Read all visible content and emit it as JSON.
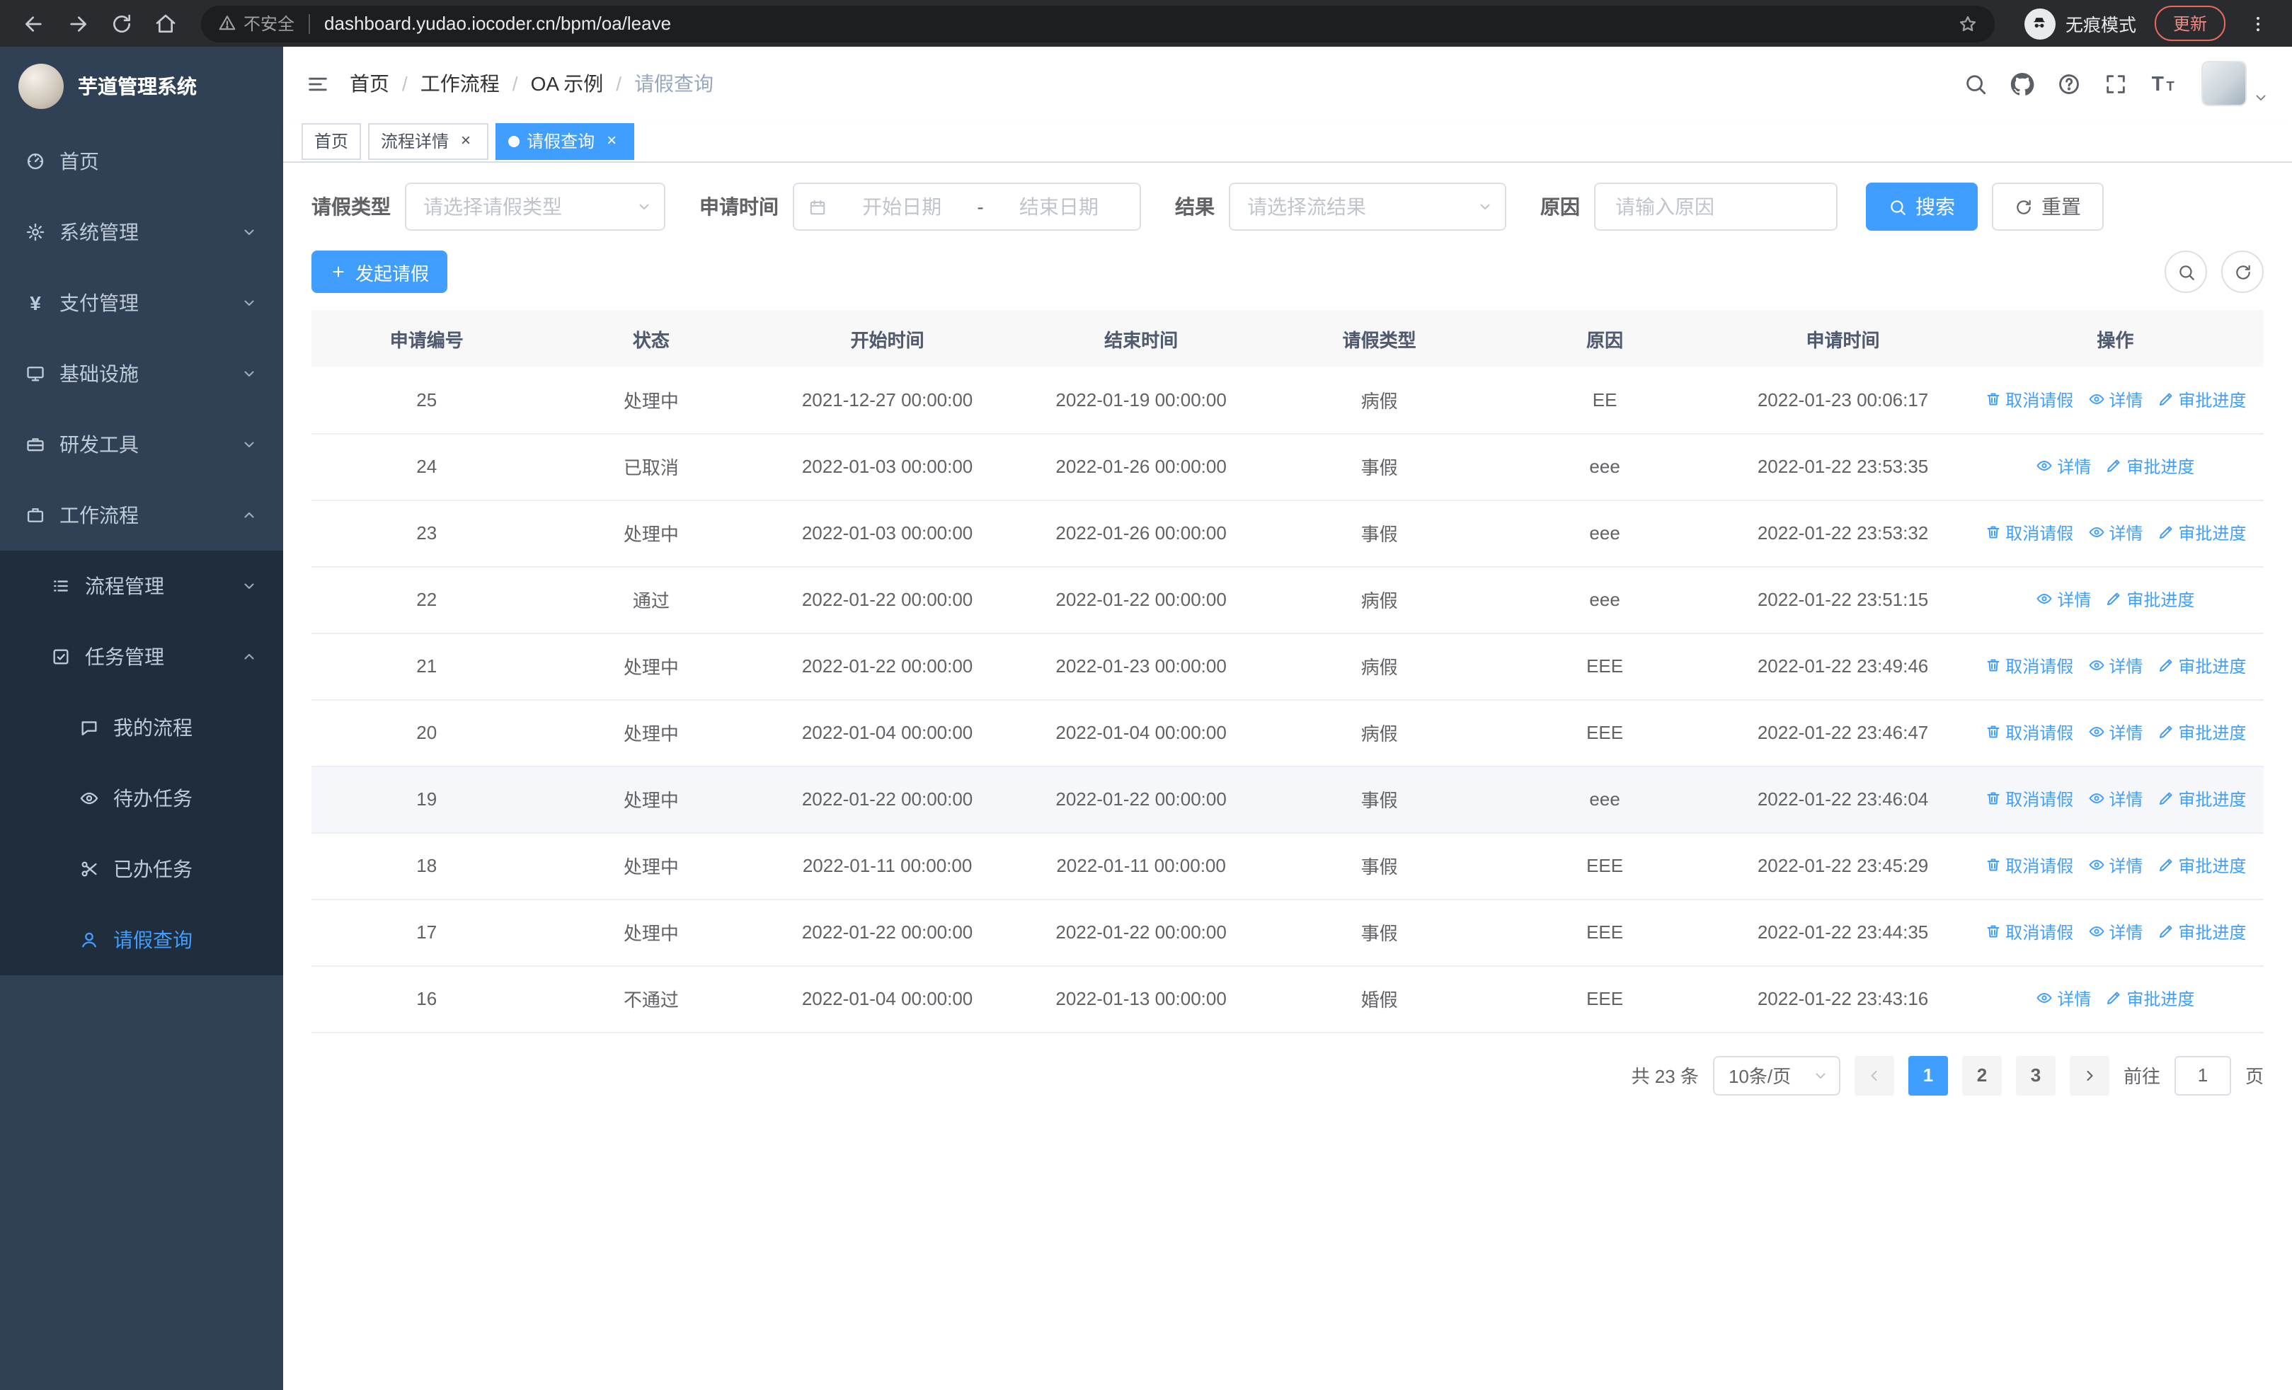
{
  "browser": {
    "security_label": "不安全",
    "url": "dashboard.yudao.iocoder.cn/bpm/oa/leave",
    "incognito_label": "无痕模式",
    "update_label": "更新"
  },
  "icons": {
    "close_glyph": "×"
  },
  "sidebar": {
    "title": "芋道管理系统",
    "items": [
      {
        "name": "home",
        "label": "首页",
        "icon": "dashboard",
        "level": 1
      },
      {
        "name": "system-management",
        "label": "系统管理",
        "icon": "gear",
        "level": 1,
        "chevron": "down"
      },
      {
        "name": "payment-management",
        "label": "支付管理",
        "icon": "yen",
        "level": 1,
        "chevron": "down"
      },
      {
        "name": "infrastructure",
        "label": "基础设施",
        "icon": "monitor",
        "level": 1,
        "chevron": "down"
      },
      {
        "name": "dev-tools",
        "label": "研发工具",
        "icon": "toolbox",
        "level": 1,
        "chevron": "down"
      },
      {
        "name": "workflow",
        "label": "工作流程",
        "icon": "briefcase",
        "level": 1,
        "chevron": "up",
        "expanded": true
      },
      {
        "name": "process-management",
        "label": "流程管理",
        "icon": "list",
        "level": 2,
        "chevron": "down"
      },
      {
        "name": "task-management",
        "label": "任务管理",
        "icon": "tasks",
        "level": 2,
        "chevron": "up",
        "expanded": true
      },
      {
        "name": "my-process",
        "label": "我的流程",
        "icon": "chat",
        "level": 3
      },
      {
        "name": "todo-tasks",
        "label": "待办任务",
        "icon": "eye",
        "level": 3
      },
      {
        "name": "done-tasks",
        "label": "已办任务",
        "icon": "scissors",
        "level": 3
      },
      {
        "name": "leave-query",
        "label": "请假查询",
        "icon": "user",
        "level": 3,
        "active": true
      }
    ]
  },
  "header": {
    "breadcrumb": [
      "首页",
      "工作流程",
      "OA 示例",
      "请假查询"
    ]
  },
  "tabs": [
    {
      "name": "home",
      "label": "首页",
      "closable": false,
      "active": false
    },
    {
      "name": "process-detail",
      "label": "流程详情",
      "closable": true,
      "active": false
    },
    {
      "name": "leave-query",
      "label": "请假查询",
      "closable": true,
      "active": true
    }
  ],
  "filters": {
    "leave_type_label": "请假类型",
    "leave_type_placeholder": "请选择请假类型",
    "apply_time_label": "申请时间",
    "start_placeholder": "开始日期",
    "range_separator": "-",
    "end_placeholder": "结束日期",
    "result_label": "结果",
    "result_placeholder": "请选择流结果",
    "reason_label": "原因",
    "reason_placeholder": "请输入原因",
    "search_label": "搜索",
    "reset_label": "重置"
  },
  "toolbar": {
    "create_label": "发起请假"
  },
  "table": {
    "columns": [
      "申请编号",
      "状态",
      "开始时间",
      "结束时间",
      "请假类型",
      "原因",
      "申请时间",
      "操作"
    ],
    "action_labels": {
      "cancel": "取消请假",
      "detail": "详情",
      "progress": "审批进度"
    },
    "rows": [
      {
        "id": "25",
        "status": "处理中",
        "start": "2021-12-27 00:00:00",
        "end": "2022-01-19 00:00:00",
        "type": "病假",
        "reason": "EE",
        "applied": "2022-01-23 00:06:17",
        "cancelable": true
      },
      {
        "id": "24",
        "status": "已取消",
        "start": "2022-01-03 00:00:00",
        "end": "2022-01-26 00:00:00",
        "type": "事假",
        "reason": "eee",
        "applied": "2022-01-22 23:53:35",
        "cancelable": false
      },
      {
        "id": "23",
        "status": "处理中",
        "start": "2022-01-03 00:00:00",
        "end": "2022-01-26 00:00:00",
        "type": "事假",
        "reason": "eee",
        "applied": "2022-01-22 23:53:32",
        "cancelable": true
      },
      {
        "id": "22",
        "status": "通过",
        "start": "2022-01-22 00:00:00",
        "end": "2022-01-22 00:00:00",
        "type": "病假",
        "reason": "eee",
        "applied": "2022-01-22 23:51:15",
        "cancelable": false
      },
      {
        "id": "21",
        "status": "处理中",
        "start": "2022-01-22 00:00:00",
        "end": "2022-01-23 00:00:00",
        "type": "病假",
        "reason": "EEE",
        "applied": "2022-01-22 23:49:46",
        "cancelable": true
      },
      {
        "id": "20",
        "status": "处理中",
        "start": "2022-01-04 00:00:00",
        "end": "2022-01-04 00:00:00",
        "type": "病假",
        "reason": "EEE",
        "applied": "2022-01-22 23:46:47",
        "cancelable": true
      },
      {
        "id": "19",
        "status": "处理中",
        "start": "2022-01-22 00:00:00",
        "end": "2022-01-22 00:00:00",
        "type": "事假",
        "reason": "eee",
        "applied": "2022-01-22 23:46:04",
        "cancelable": true,
        "hover": true
      },
      {
        "id": "18",
        "status": "处理中",
        "start": "2022-01-11 00:00:00",
        "end": "2022-01-11 00:00:00",
        "type": "事假",
        "reason": "EEE",
        "applied": "2022-01-22 23:45:29",
        "cancelable": true
      },
      {
        "id": "17",
        "status": "处理中",
        "start": "2022-01-22 00:00:00",
        "end": "2022-01-22 00:00:00",
        "type": "事假",
        "reason": "EEE",
        "applied": "2022-01-22 23:44:35",
        "cancelable": true
      },
      {
        "id": "16",
        "status": "不通过",
        "start": "2022-01-04 00:00:00",
        "end": "2022-01-13 00:00:00",
        "type": "婚假",
        "reason": "EEE",
        "applied": "2022-01-22 23:43:16",
        "cancelable": false
      }
    ]
  },
  "pagination": {
    "total_label": "共 23 条",
    "page_size_label": "10条/页",
    "pages": [
      "1",
      "2",
      "3"
    ],
    "active_page": "1",
    "goto_label": "前往",
    "goto_value": "1",
    "unit_label": "页"
  },
  "colors": {
    "primary": "#409EFF",
    "sidebar_bg": "#304156",
    "submenu_bg": "#1f2d3d"
  }
}
